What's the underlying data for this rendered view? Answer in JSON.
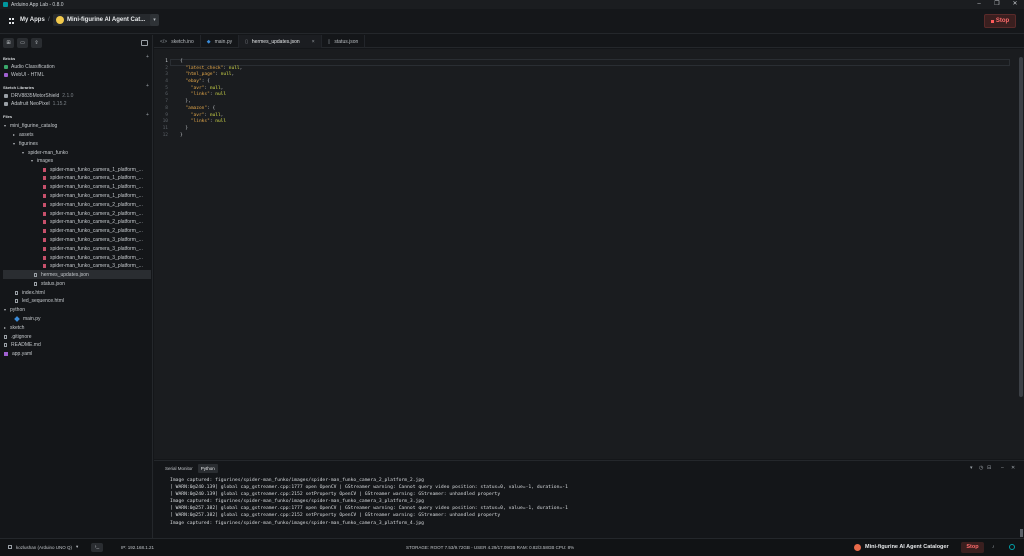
{
  "window": {
    "title": "Arduino App Lab - 0.8.0"
  },
  "header": {
    "my_apps": "My Apps",
    "separator": "/",
    "app_name": "Mini-figurine AI Agent Cat...",
    "stop_label": "Stop"
  },
  "sidebar": {
    "bricks_title": "Bricks",
    "bricks": [
      {
        "name": "Audio Classification",
        "color": "#3aa86b"
      },
      {
        "name": "WebUI - HTML",
        "color": "#a060d0"
      }
    ],
    "libs_title": "Sketch Libraries",
    "libs": [
      {
        "name": "DRV8835MotorShield",
        "version": "2.1.0"
      },
      {
        "name": "Adafruit NeoPixel",
        "version": "1.15.2"
      }
    ],
    "files_title": "Files",
    "tree": {
      "root": "mini_figurine_catalog",
      "assets": "assets",
      "figurines": "figurines",
      "spider": "spider-man_funko",
      "images": "images",
      "image_files": [
        "spider-man_funko_camera_1_platform_...",
        "spider-man_funko_camera_1_platform_...",
        "spider-man_funko_camera_1_platform_...",
        "spider-man_funko_camera_1_platform_...",
        "spider-man_funko_camera_2_platform_...",
        "spider-man_funko_camera_2_platform_...",
        "spider-man_funko_camera_2_platform_...",
        "spider-man_funko_camera_2_platform_...",
        "spider-man_funko_camera_3_platform_...",
        "spider-man_funko_camera_3_platform_...",
        "spider-man_funko_camera_3_platform_...",
        "spider-man_funko_camera_3_platform_..."
      ],
      "hermes": "hermes_updates.json",
      "status": "status.json",
      "index": "index.html",
      "led": "led_sequence.html",
      "python": "python",
      "mainpy": "main.py",
      "sketch": "sketch",
      "gitignore": ".gitignore",
      "readme": "README.md",
      "appyaml": "app.yaml"
    }
  },
  "tabs": [
    {
      "label": "sketch.ino",
      "icon": "</>"
    },
    {
      "label": "main.py",
      "icon": "◆"
    },
    {
      "label": "hermes_updates.json",
      "icon": "▯",
      "active": true,
      "close": "×"
    },
    {
      "label": "status.json",
      "icon": "▯"
    }
  ],
  "editor": {
    "line_numbers": [
      "1",
      "2",
      "3",
      "4",
      "5",
      "6",
      "7",
      "8",
      "9",
      "10",
      "11",
      "12"
    ],
    "lines": [
      [
        {
          "t": "{",
          "c": ""
        }
      ],
      [
        {
          "t": "  ",
          "c": ""
        },
        {
          "t": "\"latest_check\"",
          "c": "k"
        },
        {
          "t": ": ",
          "c": ""
        },
        {
          "t": "null",
          "c": "v"
        },
        {
          "t": ",",
          "c": ""
        }
      ],
      [
        {
          "t": "  ",
          "c": ""
        },
        {
          "t": "\"html_page\"",
          "c": "k"
        },
        {
          "t": ": ",
          "c": ""
        },
        {
          "t": "null",
          "c": "v"
        },
        {
          "t": ",",
          "c": ""
        }
      ],
      [
        {
          "t": "  ",
          "c": ""
        },
        {
          "t": "\"ebay\"",
          "c": "k"
        },
        {
          "t": ": {",
          "c": ""
        }
      ],
      [
        {
          "t": "    ",
          "c": ""
        },
        {
          "t": "\"avr\"",
          "c": "k"
        },
        {
          "t": ": ",
          "c": ""
        },
        {
          "t": "null",
          "c": "v"
        },
        {
          "t": ",",
          "c": ""
        }
      ],
      [
        {
          "t": "    ",
          "c": ""
        },
        {
          "t": "\"links\"",
          "c": "k"
        },
        {
          "t": ": ",
          "c": ""
        },
        {
          "t": "null",
          "c": "v"
        }
      ],
      [
        {
          "t": "  },",
          "c": ""
        }
      ],
      [
        {
          "t": "  ",
          "c": ""
        },
        {
          "t": "\"amazon\"",
          "c": "k"
        },
        {
          "t": ": {",
          "c": ""
        }
      ],
      [
        {
          "t": "    ",
          "c": ""
        },
        {
          "t": "\"avr\"",
          "c": "k"
        },
        {
          "t": ": ",
          "c": ""
        },
        {
          "t": "null",
          "c": "v"
        },
        {
          "t": ",",
          "c": ""
        }
      ],
      [
        {
          "t": "    ",
          "c": ""
        },
        {
          "t": "\"links\"",
          "c": "k"
        },
        {
          "t": ": ",
          "c": ""
        },
        {
          "t": "null",
          "c": "v"
        }
      ],
      [
        {
          "t": "  }",
          "c": ""
        }
      ],
      [
        {
          "t": "}",
          "c": ""
        }
      ]
    ]
  },
  "panel": {
    "tabs": [
      "Serial Monitor",
      "Python"
    ],
    "log": [
      "Image captured: figurines/spider-man_funko/images/spider-man_funko_camera_2_platform_2.jpg",
      "[ WARN:0@240.139] global cap_gstreamer.cpp:1777 open OpenCV | GStreamer warning: Cannot query video position: status=0, value=-1, duration=-1",
      "[ WARN:0@240.139] global cap_gstreamer.cpp:2152 setProperty OpenCV | GStreamer warning: GStreamer: unhandled property",
      "Image captured: figurines/spider-man_funko/images/spider-man_funko_camera_3_platform_3.jpg",
      "[ WARN:0@257.382] global cap_gstreamer.cpp:1777 open OpenCV | GStreamer warning: Cannot query video position: status=0, value=-1, duration=-1",
      "[ WARN:0@257.382] global cap_gstreamer.cpp:2152 setProperty OpenCV | GStreamer warning: GStreamer: unhandled property",
      "Image captured: figurines/spider-man_funko/images/spider-man_funko_camera_3_platform_4.jpg"
    ]
  },
  "statusbar": {
    "device": "kozlushan (Arduino UNO Q)",
    "ip": "IP: 192.168.1.21",
    "storage": "STORAGE: ROOT 7.53/9.72GB - USER 4.29/17.09GB  RAM: 0.82/3.58GB  CPU: 8%",
    "app_name": "Mini-figurine AI Agent Cataloger",
    "stop_label": "Stop"
  }
}
